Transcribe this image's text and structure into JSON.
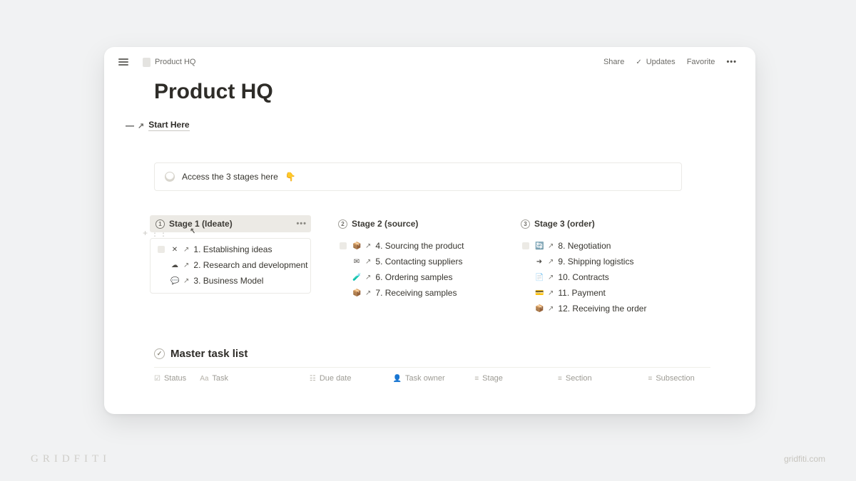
{
  "breadcrumb": "Product HQ",
  "title": "Product HQ",
  "top": {
    "share": "Share",
    "updates": "Updates",
    "favorite": "Favorite"
  },
  "start_here": "Start Here",
  "callout": "Access the 3 stages here",
  "stages": [
    {
      "num": "1",
      "label": "Stage 1 (Ideate)",
      "active": true,
      "items": [
        {
          "emoji": "✕",
          "text": "1. Establishing ideas",
          "lead_square": true
        },
        {
          "emoji": "☁",
          "text": "2. Research and development"
        },
        {
          "emoji": "💬",
          "text": "3. Business Model"
        }
      ]
    },
    {
      "num": "2",
      "label": "Stage 2 (source)",
      "items": [
        {
          "emoji": "📦",
          "text": "4. Sourcing the product",
          "lead_square": true
        },
        {
          "emoji": "✉",
          "text": "5. Contacting suppliers"
        },
        {
          "emoji": "🧪",
          "text": "6. Ordering samples"
        },
        {
          "emoji": "📦",
          "text": "7. Receiving samples"
        }
      ]
    },
    {
      "num": "3",
      "label": "Stage 3 (order)",
      "items": [
        {
          "emoji": "🔄",
          "text": "8. Negotiation",
          "lead_square": true
        },
        {
          "emoji": "➜",
          "text": "9. Shipping logistics"
        },
        {
          "emoji": "📄",
          "text": "10. Contracts"
        },
        {
          "emoji": "💳",
          "text": "11. Payment"
        },
        {
          "emoji": "📦",
          "text": "12. Receiving the order"
        }
      ]
    }
  ],
  "master": {
    "title": "Master task list",
    "columns": [
      "Status",
      "Task",
      "Due date",
      "Task owner",
      "Stage",
      "Section",
      "Subsection"
    ]
  },
  "brand_left": "GRIDFITI",
  "brand_right": "gridfiti.com"
}
